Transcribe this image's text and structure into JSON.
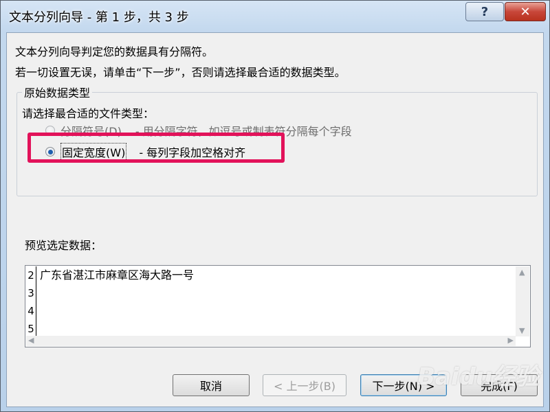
{
  "window": {
    "title": "文本分列向导 - 第 1 步，共 3 步",
    "help_label": "?",
    "close_label": "✕"
  },
  "intro": {
    "line1": "文本分列向导判定您的数据具有分隔符。",
    "line2": "若一切设置无误，请单击“下一步”，否则请选择最合适的数据类型。"
  },
  "original_type": {
    "legend": "原始数据类型",
    "prompt": "请选择最合适的文件类型：",
    "options": [
      {
        "label": "分隔符号(D)",
        "desc": "- 用分隔字符，如逗号或制表符分隔每个字段",
        "checked": false
      },
      {
        "label": "固定宽度(W)",
        "desc": "- 每列字段加空格对齐",
        "checked": true
      }
    ]
  },
  "preview": {
    "label": "预览选定数据：",
    "rows": [
      {
        "num": "2",
        "text": "广东省湛江市麻章区海大路一号"
      },
      {
        "num": "3",
        "text": ""
      },
      {
        "num": "4",
        "text": ""
      },
      {
        "num": "5",
        "text": ""
      }
    ]
  },
  "buttons": {
    "cancel": "取消",
    "back": "< 上一步(B)",
    "next": "下一步(N) >",
    "finish": "完成(F)"
  },
  "watermark": "Baidu经验",
  "colors": {
    "highlight": "#e2125a",
    "radio_dot": "#1f5fae",
    "close_button": "#c8473a"
  }
}
